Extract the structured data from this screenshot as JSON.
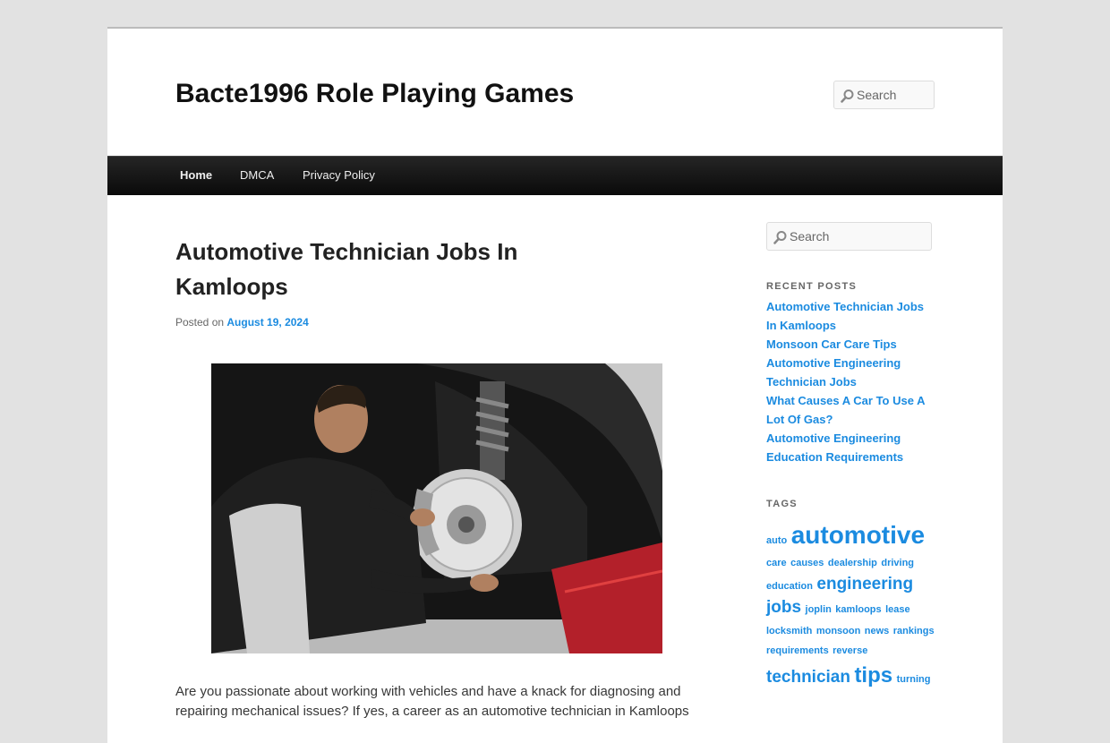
{
  "site": {
    "title": "Bacte1996 Role Playing Games"
  },
  "header_search": {
    "placeholder": "Search"
  },
  "nav": {
    "items": [
      "Home",
      "DMCA",
      "Privacy Policy"
    ]
  },
  "post": {
    "title": "Automotive Technician Jobs In Kamloops",
    "posted_on_label": "Posted on",
    "date": "August 19, 2024",
    "image_alt": "mechanic-installing-brake-disc",
    "paragraph": "Are you passionate about working with vehicles and have a knack for diagnosing and repairing mechanical issues? If yes, a career as an automotive technician in Kamloops"
  },
  "sidebar": {
    "search_placeholder": "Search",
    "recent_posts_title": "Recent Posts",
    "recent_posts": [
      "Automotive Technician Jobs In Kamloops",
      "Monsoon Car Care Tips",
      "Automotive Engineering Technician Jobs",
      "What Causes A Car To Use A Lot Of Gas?",
      "Automotive Engineering Education Requirements"
    ],
    "tags_title": "Tags",
    "tags": [
      {
        "name": "auto",
        "size": 11
      },
      {
        "name": "automotive",
        "size": 28
      },
      {
        "name": "care",
        "size": 11
      },
      {
        "name": "causes",
        "size": 11
      },
      {
        "name": "dealership",
        "size": 11
      },
      {
        "name": "driving",
        "size": 11
      },
      {
        "name": "education",
        "size": 11
      },
      {
        "name": "engineering",
        "size": 19
      },
      {
        "name": "jobs",
        "size": 19
      },
      {
        "name": "joplin",
        "size": 11
      },
      {
        "name": "kamloops",
        "size": 11
      },
      {
        "name": "lease",
        "size": 11
      },
      {
        "name": "locksmith",
        "size": 11
      },
      {
        "name": "monsoon",
        "size": 11
      },
      {
        "name": "news",
        "size": 11
      },
      {
        "name": "rankings",
        "size": 11
      },
      {
        "name": "requirements",
        "size": 11
      },
      {
        "name": "reverse",
        "size": 11
      },
      {
        "name": "technician",
        "size": 19
      },
      {
        "name": "tips",
        "size": 24
      },
      {
        "name": "turning",
        "size": 11
      }
    ]
  },
  "colors": {
    "link": "#1b8be0",
    "nav_bg": "#1a1a1a",
    "page_bg": "#e2e2e2"
  }
}
